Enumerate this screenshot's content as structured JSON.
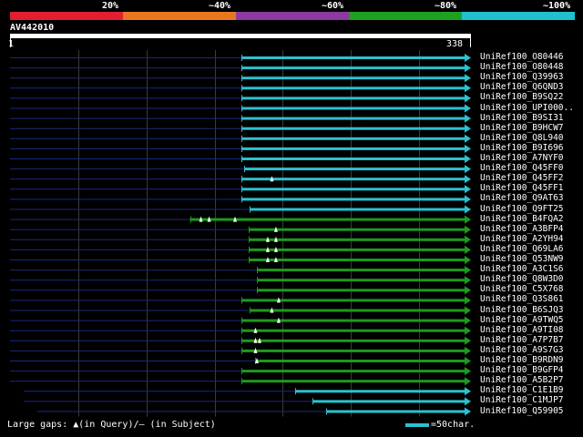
{
  "legend": {
    "labels": [
      "20%",
      "~40%",
      "~60%",
      "~80%",
      "~100%"
    ],
    "colors": [
      "#e02030",
      "#e87820",
      "#8a3aa0",
      "#20a020",
      "#20c0d0"
    ]
  },
  "query": {
    "name": "AV442010",
    "start": "1",
    "end": "338",
    "length": 338
  },
  "gridlines_at": [
    50,
    100,
    150,
    200,
    250,
    300
  ],
  "hits": [
    {
      "name": "UniRef100_O80446",
      "color": "cyan",
      "subject_start": 0,
      "query_start": 170,
      "query_end": 338,
      "markers": []
    },
    {
      "name": "UniRef100_O80448",
      "color": "cyan",
      "subject_start": 0,
      "query_start": 170,
      "query_end": 338,
      "markers": []
    },
    {
      "name": "UniRef100_Q39963",
      "color": "cyan",
      "subject_start": 0,
      "query_start": 170,
      "query_end": 338,
      "markers": []
    },
    {
      "name": "UniRef100_Q6QND3",
      "color": "cyan",
      "subject_start": 0,
      "query_start": 170,
      "query_end": 338,
      "markers": []
    },
    {
      "name": "UniRef100_B9SQ22",
      "color": "cyan",
      "subject_start": 0,
      "query_start": 170,
      "query_end": 338,
      "markers": []
    },
    {
      "name": "UniRef100_UPI000..",
      "color": "cyan",
      "subject_start": 0,
      "query_start": 170,
      "query_end": 338,
      "markers": []
    },
    {
      "name": "UniRef100_B9SI31",
      "color": "cyan",
      "subject_start": 0,
      "query_start": 170,
      "query_end": 338,
      "markers": []
    },
    {
      "name": "UniRef100_B9HCW7",
      "color": "cyan",
      "subject_start": 0,
      "query_start": 170,
      "query_end": 338,
      "markers": []
    },
    {
      "name": "UniRef100_Q8L940",
      "color": "cyan",
      "subject_start": 0,
      "query_start": 170,
      "query_end": 338,
      "markers": []
    },
    {
      "name": "UniRef100_B9I696",
      "color": "cyan",
      "subject_start": 0,
      "query_start": 170,
      "query_end": 338,
      "markers": []
    },
    {
      "name": "UniRef100_A7NYF0",
      "color": "cyan",
      "subject_start": 0,
      "query_start": 170,
      "query_end": 338,
      "markers": []
    },
    {
      "name": "UniRef100_Q45FF0",
      "color": "cyan",
      "subject_start": 0,
      "query_start": 172,
      "query_end": 338,
      "markers": []
    },
    {
      "name": "UniRef100_Q45FF2",
      "color": "cyan",
      "subject_start": 0,
      "query_start": 170,
      "query_end": 338,
      "markers": [
        192
      ]
    },
    {
      "name": "UniRef100_Q45FF1",
      "color": "cyan",
      "subject_start": 0,
      "query_start": 170,
      "query_end": 338,
      "markers": []
    },
    {
      "name": "UniRef100_Q9AT63",
      "color": "cyan",
      "subject_start": 0,
      "query_start": 170,
      "query_end": 338,
      "markers": []
    },
    {
      "name": "UniRef100_Q9FT25",
      "color": "cyan",
      "subject_start": 0,
      "query_start": 176,
      "query_end": 338,
      "markers": []
    },
    {
      "name": "UniRef100_B4FQA2",
      "color": "green",
      "subject_start": 0,
      "query_start": 132,
      "query_end": 338,
      "markers": [
        140,
        146,
        165
      ]
    },
    {
      "name": "UniRef100_A3BFP4",
      "color": "green",
      "subject_start": 0,
      "query_start": 175,
      "query_end": 338,
      "markers": [
        195
      ]
    },
    {
      "name": "UniRef100_A2YH94",
      "color": "green",
      "subject_start": 0,
      "query_start": 175,
      "query_end": 338,
      "markers": [
        189,
        195
      ]
    },
    {
      "name": "UniRef100_Q69LA6",
      "color": "green",
      "subject_start": 0,
      "query_start": 175,
      "query_end": 338,
      "markers": [
        189,
        195
      ]
    },
    {
      "name": "UniRef100_Q53NW9",
      "color": "green",
      "subject_start": 0,
      "query_start": 175,
      "query_end": 338,
      "markers": [
        189,
        195
      ]
    },
    {
      "name": "UniRef100_A3C1S6",
      "color": "green",
      "subject_start": 0,
      "query_start": 181,
      "query_end": 338,
      "markers": []
    },
    {
      "name": "UniRef100_Q8W3D0",
      "color": "green",
      "subject_start": 0,
      "query_start": 181,
      "query_end": 338,
      "markers": []
    },
    {
      "name": "UniRef100_C5X768",
      "color": "green",
      "subject_start": 0,
      "query_start": 181,
      "query_end": 338,
      "markers": []
    },
    {
      "name": "UniRef100_Q3S861",
      "color": "green",
      "subject_start": 0,
      "query_start": 170,
      "query_end": 338,
      "markers": [
        197
      ]
    },
    {
      "name": "UniRef100_B6SJQ3",
      "color": "green",
      "subject_start": 0,
      "query_start": 176,
      "query_end": 338,
      "markers": [
        192
      ]
    },
    {
      "name": "UniRef100_A9TWQ5",
      "color": "green",
      "subject_start": 0,
      "query_start": 170,
      "query_end": 338,
      "markers": [
        197
      ]
    },
    {
      "name": "UniRef100_A9TI08",
      "color": "green",
      "subject_start": 0,
      "query_start": 170,
      "query_end": 338,
      "markers": [
        180
      ]
    },
    {
      "name": "UniRef100_A7P7B7",
      "color": "green",
      "subject_start": 0,
      "query_start": 170,
      "query_end": 338,
      "markers": [
        180,
        183
      ]
    },
    {
      "name": "UniRef100_A9S7G3",
      "color": "green",
      "subject_start": 0,
      "query_start": 170,
      "query_end": 338,
      "markers": [
        180
      ]
    },
    {
      "name": "UniRef100_B9RDN9",
      "color": "green",
      "subject_start": 0,
      "query_start": 180,
      "query_end": 338,
      "markers": [
        181
      ]
    },
    {
      "name": "UniRef100_B9GFP4",
      "color": "green",
      "subject_start": 0,
      "query_start": 170,
      "query_end": 338,
      "markers": []
    },
    {
      "name": "UniRef100_A5B2P7",
      "color": "green",
      "subject_start": 0,
      "query_start": 170,
      "query_end": 338,
      "markers": []
    },
    {
      "name": "UniRef100_C1E1B9",
      "color": "cyan",
      "subject_start": 10,
      "query_start": 209,
      "query_end": 338,
      "markers": []
    },
    {
      "name": "UniRef100_C1MJP7",
      "color": "cyan",
      "subject_start": 10,
      "query_start": 222,
      "query_end": 338,
      "markers": []
    },
    {
      "name": "UniRef100_Q59905",
      "color": "cyan",
      "subject_start": 20,
      "query_start": 232,
      "query_end": 338,
      "markers": []
    }
  ],
  "footer": {
    "gaps_text": "Large gaps: ▲(in Query)/– (in Subject)",
    "scale_text": "=50char."
  }
}
